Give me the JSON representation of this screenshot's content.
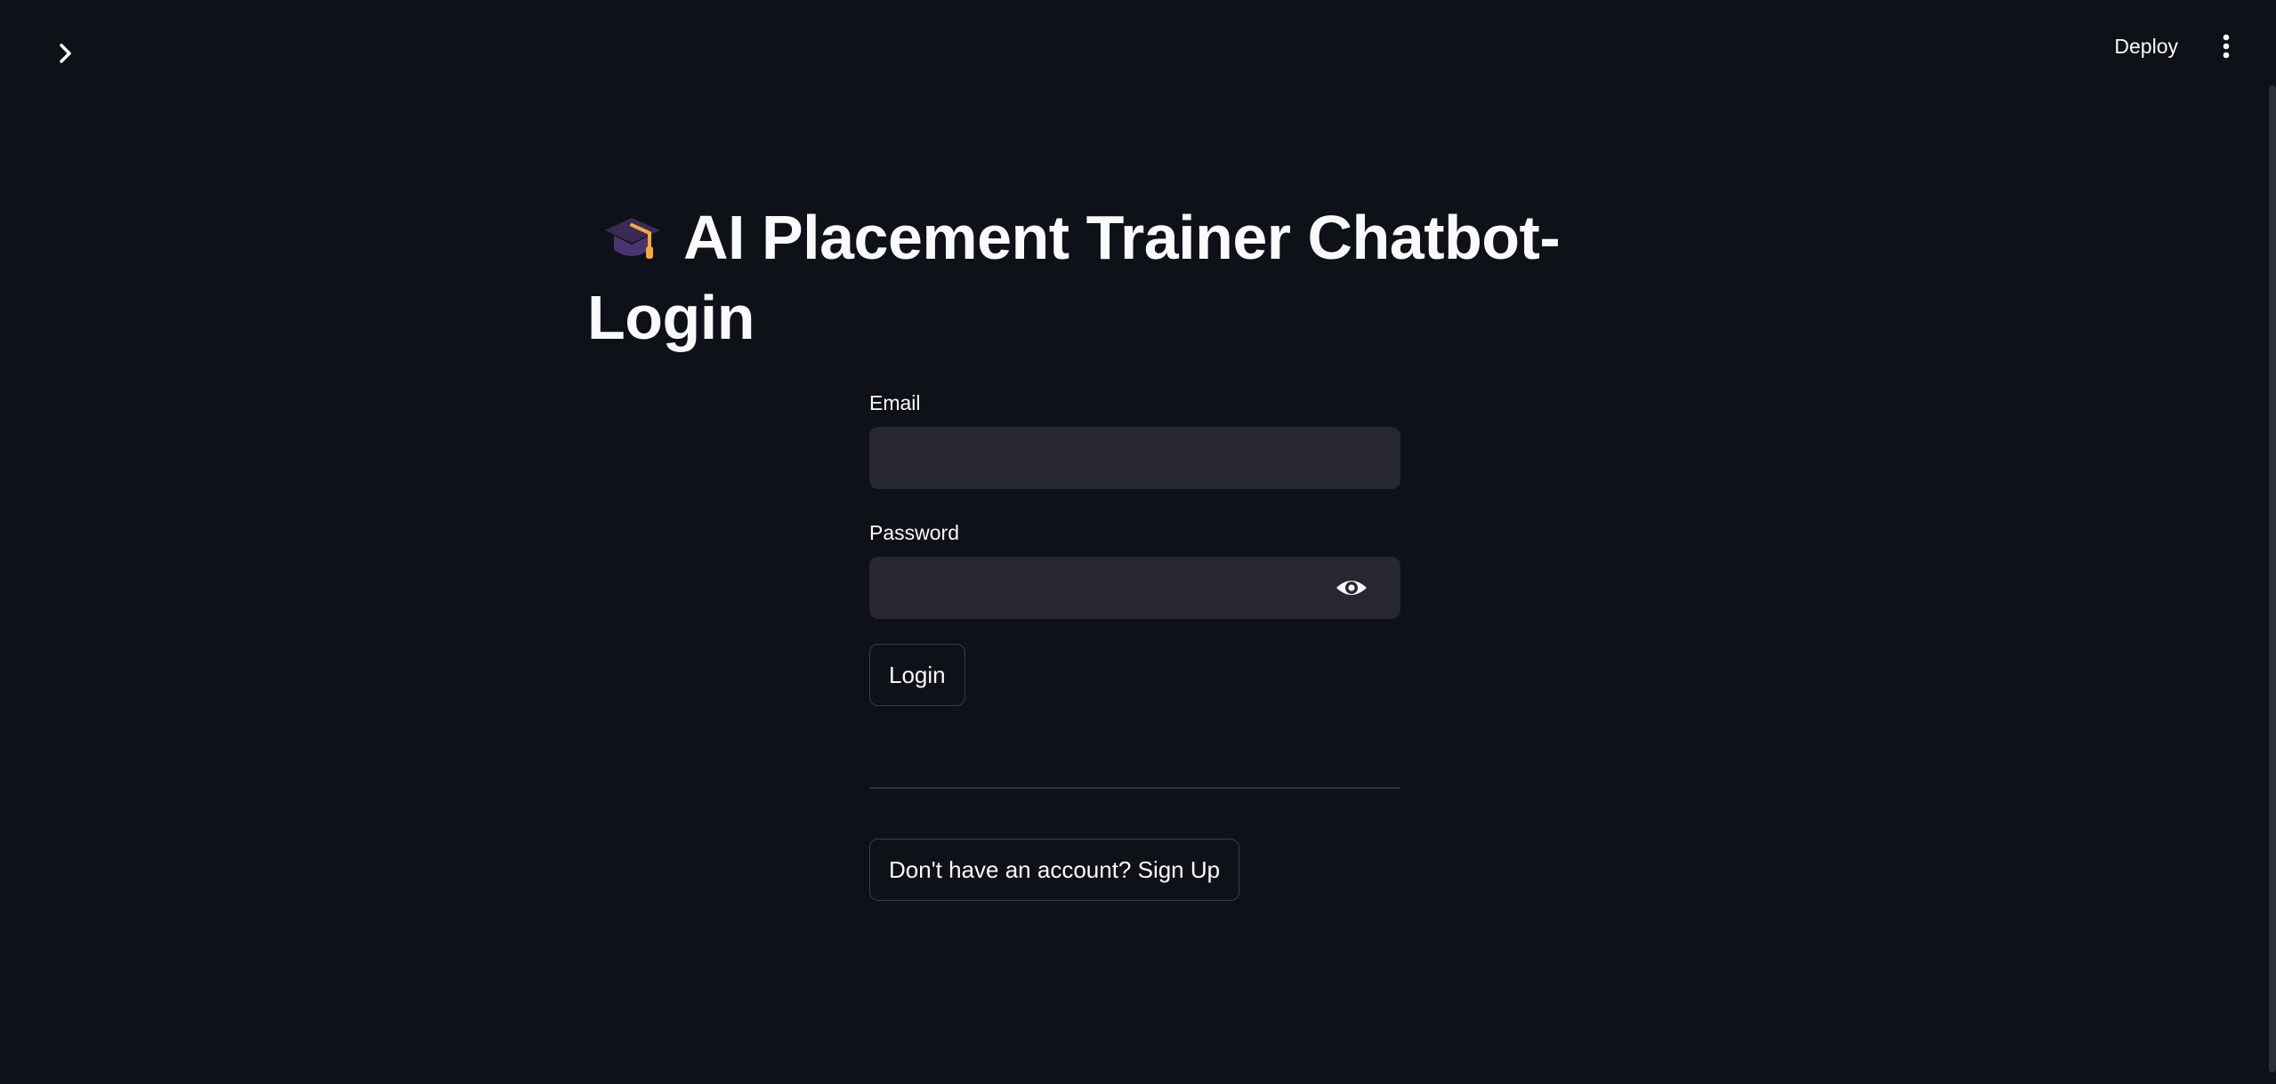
{
  "header": {
    "deploy_label": "Deploy"
  },
  "icons": {
    "sidebar_toggle": "chevron-right-icon",
    "menu": "kebab-menu-icon",
    "title_emoji": "graduation-cap-icon",
    "password_toggle": "eye-icon"
  },
  "page": {
    "title": "AI Placement Trainer Chatbot-Login"
  },
  "form": {
    "email_label": "Email",
    "email_value": "",
    "password_label": "Password",
    "password_value": "",
    "login_label": "Login"
  },
  "footer": {
    "signup_label": "Don't have an account? Sign Up"
  },
  "colors": {
    "background": "#0e1117",
    "input_background": "#262730",
    "text": "#fafafa",
    "border": "#3a3d45"
  }
}
